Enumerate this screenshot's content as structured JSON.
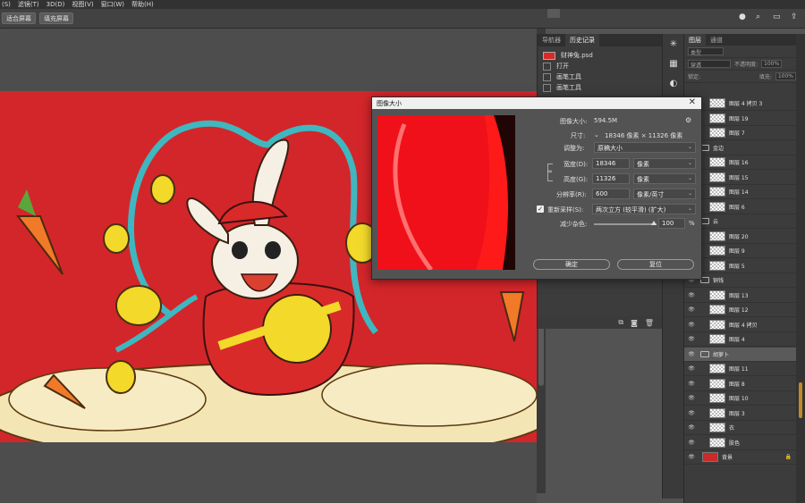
{
  "menu": [
    "(S)",
    "滤镜(T)",
    "3D(D)",
    "视图(V)",
    "窗口(W)",
    "帮助(H)"
  ],
  "options": {
    "fit_screen": "适合屏幕",
    "fill_screen": "填充屏幕"
  },
  "history": {
    "tabs": [
      "导航器",
      "历史记录"
    ],
    "file_name": "财神兔.psd",
    "items": [
      "打开",
      "画笔工具",
      "画笔工具"
    ]
  },
  "layers": {
    "tabs": [
      "图层",
      "通道"
    ],
    "kind_placeholder": "类型",
    "mode_placeholder": "穿透",
    "opacity_label": "不透明度:",
    "opacity_value": "100%",
    "lock_label": "锁定:",
    "fill_label": "填充:",
    "fill_value": "100%",
    "rows": [
      {
        "name": "图层 4 拷贝 3",
        "type": "layer"
      },
      {
        "name": "图层 19",
        "type": "layer"
      },
      {
        "name": "图层 7",
        "type": "layer"
      },
      {
        "name": "金边",
        "type": "group"
      },
      {
        "name": "图层 16",
        "type": "layer"
      },
      {
        "name": "图层 15",
        "type": "layer"
      },
      {
        "name": "图层 14",
        "type": "layer"
      },
      {
        "name": "图层 6",
        "type": "layer"
      },
      {
        "name": "云",
        "type": "group"
      },
      {
        "name": "图层 20",
        "type": "layer"
      },
      {
        "name": "图层 9",
        "type": "layer"
      },
      {
        "name": "图层 5",
        "type": "layer"
      },
      {
        "name": "铜钱",
        "type": "group"
      },
      {
        "name": "图层 13",
        "type": "layer"
      },
      {
        "name": "图层 12",
        "type": "layer"
      },
      {
        "name": "图层 4 拷贝",
        "type": "layer"
      },
      {
        "name": "图层 4",
        "type": "layer"
      },
      {
        "name": "胡萝卜",
        "type": "group"
      },
      {
        "name": "图层 11",
        "type": "layer"
      },
      {
        "name": "图层 8",
        "type": "layer"
      },
      {
        "name": "图层 10",
        "type": "layer"
      },
      {
        "name": "图层 3",
        "type": "layer"
      },
      {
        "name": "衣",
        "type": "layer"
      },
      {
        "name": "肤色",
        "type": "layer"
      },
      {
        "name": "背景",
        "type": "background"
      }
    ]
  },
  "dialog": {
    "title": "图像大小",
    "image_size_label": "图像大小:",
    "image_size_value": "594.5M",
    "dimensions_label": "尺寸:",
    "dimensions_value": "18346 像素 × 11326 像素",
    "fit_label": "调整为:",
    "fit_value": "原稿大小",
    "width_label": "宽度(D):",
    "width_value": "18346",
    "width_unit": "像素",
    "height_label": "高度(G):",
    "height_value": "11326",
    "height_unit": "像素",
    "resolution_label": "分辨率(R):",
    "resolution_value": "600",
    "resolution_unit": "像素/英寸",
    "resample_label": "重新采样(S):",
    "resample_value": "两次立方 (较平滑) (扩大)",
    "noise_label": "减少杂色:",
    "noise_value": "100",
    "noise_unit": "%",
    "ok": "确定",
    "cancel": "复位"
  }
}
